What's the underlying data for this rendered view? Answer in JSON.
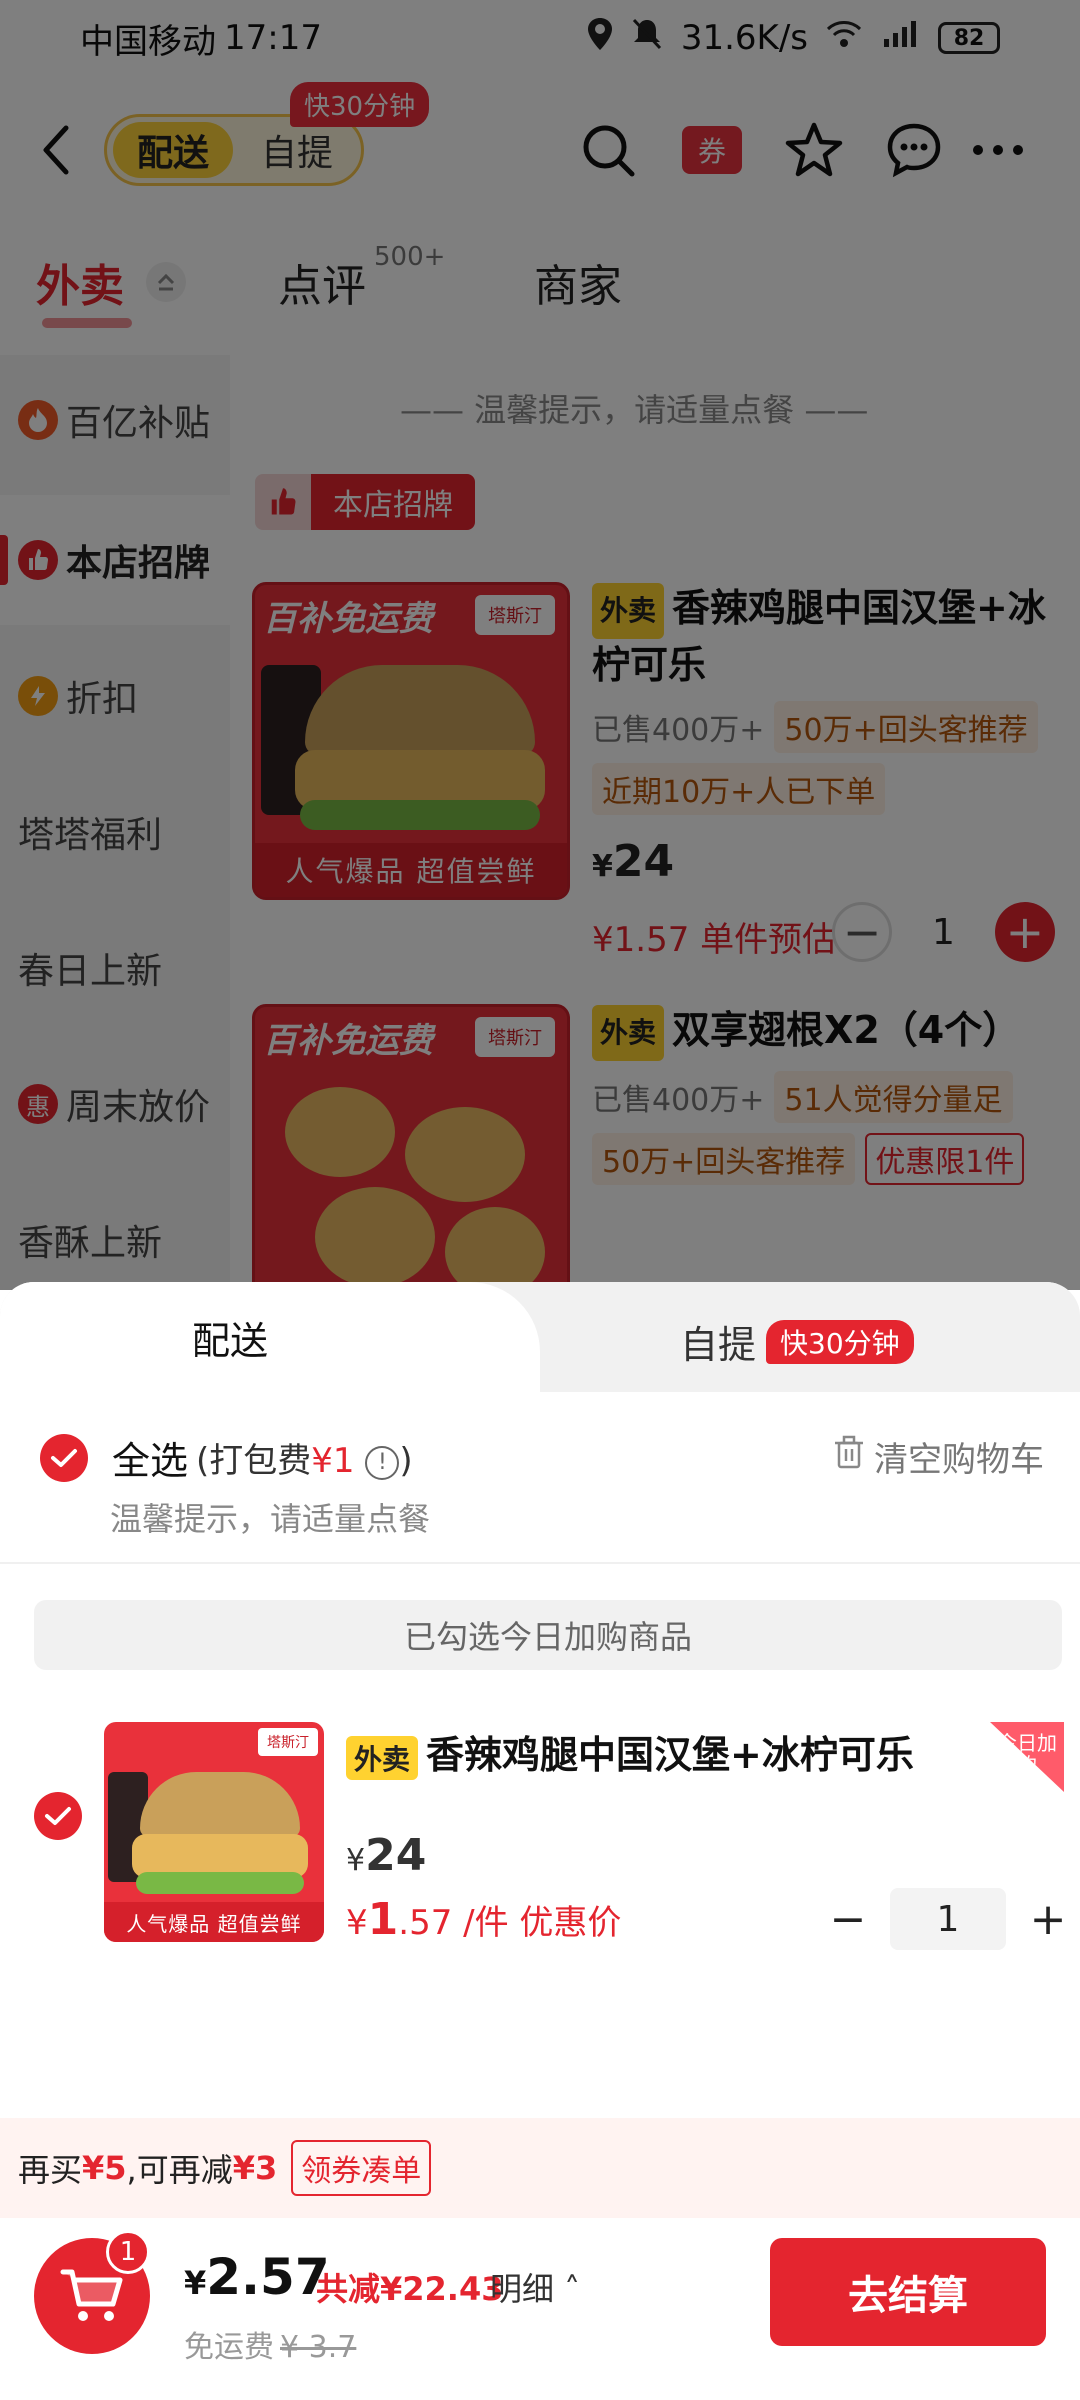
{
  "status_bar": {
    "carrier": "中国移动",
    "time": "17:17",
    "net_speed": "31.6K/s",
    "network": "4G",
    "battery": "82"
  },
  "top_nav": {
    "mode_active": "配送",
    "mode_inactive": "自提",
    "fast_tag": "快30分钟",
    "coupon_icon_text": "券"
  },
  "tabs": [
    {
      "label": "外卖",
      "active": true
    },
    {
      "label": "点评",
      "sup": "500+"
    },
    {
      "label": "商家"
    }
  ],
  "sidebar": {
    "items": [
      {
        "label": "百亿补贴",
        "icon": "flame-icon"
      },
      {
        "label": "本店招牌",
        "icon": "thumbs-up-icon",
        "active": true
      },
      {
        "label": "折扣",
        "icon": "discount-icon"
      },
      {
        "label": "塔塔福利"
      },
      {
        "label": "春日上新"
      },
      {
        "label": "周末放价",
        "icon_text": "惠"
      },
      {
        "label": "香酥上新"
      }
    ]
  },
  "menu": {
    "hint": "—— 温馨提示，请适量点餐 ——",
    "section_badge": "本店招牌",
    "products": [
      {
        "image_banner": "百补免运费",
        "image_brand": "塔斯汀",
        "image_footer": "人气爆品 超值尝鲜",
        "tag": "外卖",
        "title": "香辣鸡腿中国汉堡+冰柠可乐",
        "sold": "已售400万+",
        "pills": [
          "50万+回头客推荐",
          "近期10万+人已下单"
        ],
        "price": "24",
        "currency": "¥",
        "deal_price": "¥1.57",
        "deal_label": "单件预估",
        "qty": "1"
      },
      {
        "image_banner": "百补免运费",
        "image_brand": "塔斯汀",
        "tag": "外卖",
        "title": "双享翅根X2（4个）",
        "sold": "已售400万+",
        "pills": [
          "51人觉得分量足",
          "50万+回头客推荐"
        ],
        "limit": "优惠限1件"
      }
    ]
  },
  "sheet": {
    "tab_active": "配送",
    "tab_inactive": "自提",
    "tab_fast": "快30分钟",
    "select_all": "全选",
    "pack_fee_prefix": "(打包费",
    "pack_fee_value": "¥1",
    "pack_fee_suffix": ")",
    "info_icon": "!",
    "clear_cart": "清空购物车",
    "hint": "温馨提示，请适量点餐",
    "section_banner": "已勾选今日加购商品",
    "cart_item": {
      "image_brand": "塔斯汀",
      "image_footer": "人气爆品 超值尝鲜",
      "tag": "外卖",
      "title": "香辣鸡腿中国汉堡+冰柠可乐",
      "badge": "今日加购",
      "currency": "¥",
      "price": "24",
      "deal_currency": "¥",
      "deal_int": "1",
      "deal_dec": ".57",
      "deal_unit": "/件 优惠价",
      "qty": "1",
      "minus": "−",
      "plus": "+"
    }
  },
  "promo": {
    "text1": "再买",
    "amount1": "¥5",
    "text2": ",可再减",
    "amount2": "¥3",
    "button": "领券凑单"
  },
  "checkout": {
    "cart_count": "1",
    "currency": "¥",
    "total": "2.57",
    "saved": "共减¥22.43",
    "detail": "明细 ˄",
    "delivery_label": "免运费",
    "delivery_old": "¥ 3.7",
    "button": "去结算"
  }
}
